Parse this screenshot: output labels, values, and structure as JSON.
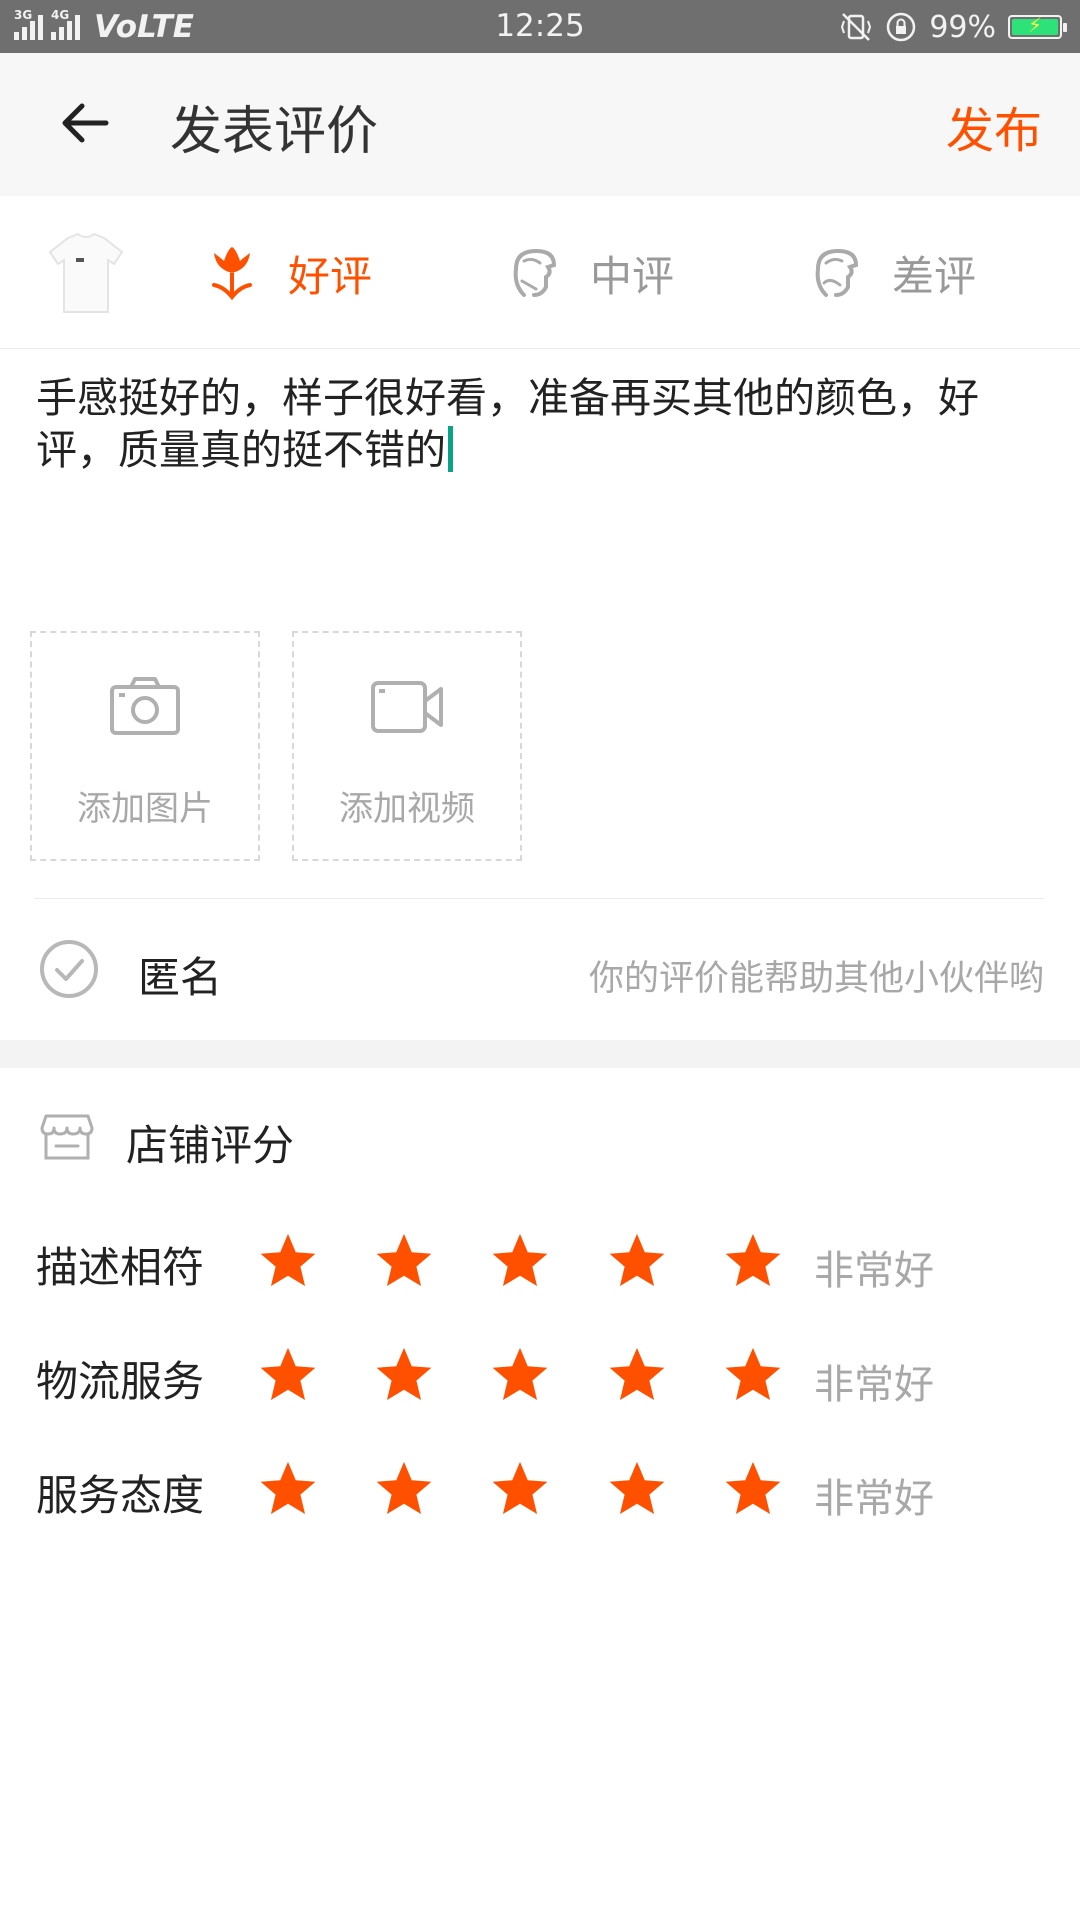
{
  "status_bar": {
    "network_left": "3G",
    "network_right": "4G",
    "volte": "VoLTE",
    "time": "12:25",
    "battery_percent": "99%",
    "battery_level": 0.99,
    "battery_color": "#2ee27a"
  },
  "header": {
    "title": "发表评价",
    "publish_label": "发布",
    "accent_color": "#ff5000"
  },
  "rating_type": {
    "selected": "good",
    "options": [
      {
        "id": "good",
        "label": "好评",
        "icon": "flower-icon"
      },
      {
        "id": "mid",
        "label": "中评",
        "icon": "neutral-face-icon"
      },
      {
        "id": "bad",
        "label": "差评",
        "icon": "sad-face-icon"
      }
    ]
  },
  "review": {
    "text": "手感挺好的，样子很好看，准备再买其他的颜色，好评，质量真的挺不错的"
  },
  "uploads": {
    "photo_label": "添加图片",
    "video_label": "添加视频"
  },
  "anonymous": {
    "label": "匿名",
    "hint": "你的评价能帮助其他小伙伴哟"
  },
  "shop_rating": {
    "title": "店铺评分",
    "items": [
      {
        "label": "描述相符",
        "stars": 5,
        "max": 5,
        "text": "非常好"
      },
      {
        "label": "物流服务",
        "stars": 5,
        "max": 5,
        "text": "非常好"
      },
      {
        "label": "服务态度",
        "stars": 5,
        "max": 5,
        "text": "非常好"
      }
    ]
  }
}
